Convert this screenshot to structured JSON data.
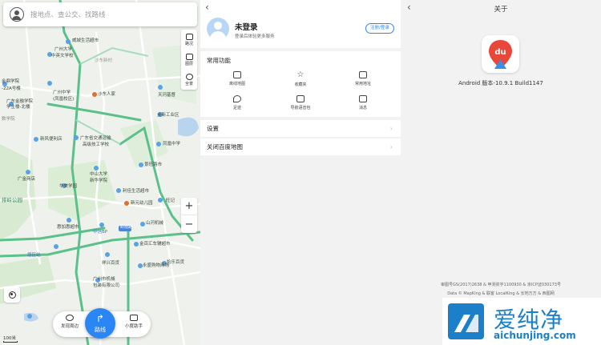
{
  "map": {
    "search_placeholder": "搜地点、查公交、找路线",
    "tools": [
      "路况",
      "图层",
      "全景"
    ],
    "zoom_in": "+",
    "zoom_out": "−",
    "labels": {
      "weiwei": "威城生活超市",
      "gzdx": "广州大学",
      "zhhy": "中英文学校",
      "fucheng": "沙东新村",
      "jinding": "金鼎学院",
      "gzjrxy": "广东金融学院",
      "gz22": "-22A号楼",
      "zhuzhou": "学主楼-北楼",
      "gzzx": "广州中学",
      "fengjing": "(凤凰校区)",
      "shaheren": "沙东人家",
      "tianhe": "天河基督",
      "xueyuan": "数学院",
      "jinxin": "金新工业区",
      "xinfeng": "新风便利店",
      "guangdong": "广东省交通运输",
      "gaoji": "高级技工学校",
      "fenghuang": "凤凰中学",
      "shuiwang": "景旺路市",
      "gongyuan": "广金商店",
      "zhongshan": "中山大学",
      "xinhua": "新华学院",
      "huamei": "华美学园",
      "lizi": "利佳生活超市",
      "paling": "排岭公园",
      "xinyuan": "新元幼儿园",
      "shangsheng": "山河机械",
      "xima": "惠加惠超市",
      "zhongguo": "中信BP",
      "jinjiang": "金百汇车辅超市",
      "xiangxing": "祥兴百货",
      "daxiu": "永盛购物商场",
      "juxin": "恰乐百货",
      "gzjs": "广州市机械",
      "baozhuang": "包装有限公司",
      "yidong": "旺记",
      "road1": "岭南路",
      "road2": "增区站"
    },
    "bottom_left": "发现周边",
    "route": "路线",
    "bottom_right": "小度助手",
    "scale": "100米"
  },
  "menu": {
    "back": "‹",
    "title": "未登录",
    "subtitle": "登录后体验更多服务",
    "login_button": "注册/登录",
    "section_title": "常用功能",
    "functions": [
      "离线地图",
      "收藏夹",
      "常用地址",
      "足迹",
      "导航语音包",
      "消息"
    ],
    "rows": [
      "设置",
      "关闭百度地图"
    ]
  },
  "about": {
    "back": "‹",
    "title": "关于",
    "version": "Android 版本-10.9.1 Build1147",
    "footer1": "审图号GS(2017)2638 & 甲测资字1100930 & 京ICP证030173号",
    "footer2": "Data © MapKing & 联客 LocalKing & 长地万方 & 西图网"
  },
  "watermark": {
    "cn": "爱纯净",
    "en": "aichunjing.com"
  },
  "colors": {
    "accent": "#2b86f5",
    "road_green": "#5cc08a",
    "baidu_red": "#e8473a",
    "watermark_blue": "#1b7fc9"
  }
}
